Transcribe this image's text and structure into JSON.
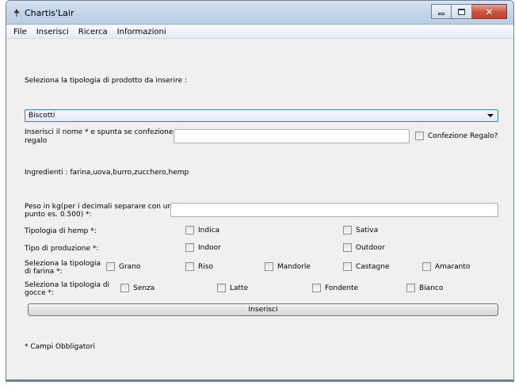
{
  "window": {
    "title": "Chartis'Lair"
  },
  "menu": [
    "File",
    "Inserisci",
    "Ricerca",
    "Informazioni"
  ],
  "form": {
    "product_type_label": "Seleziona la tipologia di prodotto da inserire :",
    "product_type_value": "Biscotti",
    "name_label_1": "Inserisci il nome * e spunta se confezione",
    "name_label_2": "regalo",
    "name_value": "",
    "gift_checkbox_label": "Confezione Regalo?",
    "ingredients_text": "Ingredienti : farina,uova,burro,zucchero,hemp",
    "weight_label_1": "Peso in kg(per i decimali separare con un",
    "weight_label_2": "punto es. 0.500) *:",
    "weight_value": "",
    "hemp_label": "Tipologia di hemp *:",
    "hemp_options": [
      "Indica",
      "Sativa"
    ],
    "production_label": "Tipo di produzione *:",
    "production_options": [
      "Indoor",
      "Outdoor"
    ],
    "flour_label_1": "Seleziona la tipologia",
    "flour_label_2": "di farina *:",
    "flour_options": [
      "Grano",
      "Riso",
      "Mandorle",
      "Castagne",
      "Amaranto"
    ],
    "drops_label_1": "Seleziona la tipologia di",
    "drops_label_2": "gocce *:",
    "drops_options": [
      "Senza",
      "Latte",
      "Fondente",
      "Bianco"
    ],
    "submit_label": "Inserisci",
    "required_note": "* Campi Obbligatori"
  },
  "icons": {
    "app": "cannabis-leaf-icon",
    "minimize": "minimize-icon",
    "maximize": "maximize-icon",
    "close": "close-icon",
    "dropdown": "chevron-down-icon"
  },
  "colors": {
    "combo_border": "#3b7bd0",
    "close_button": "#c9523b",
    "window_bg": "#f0f0f0"
  }
}
